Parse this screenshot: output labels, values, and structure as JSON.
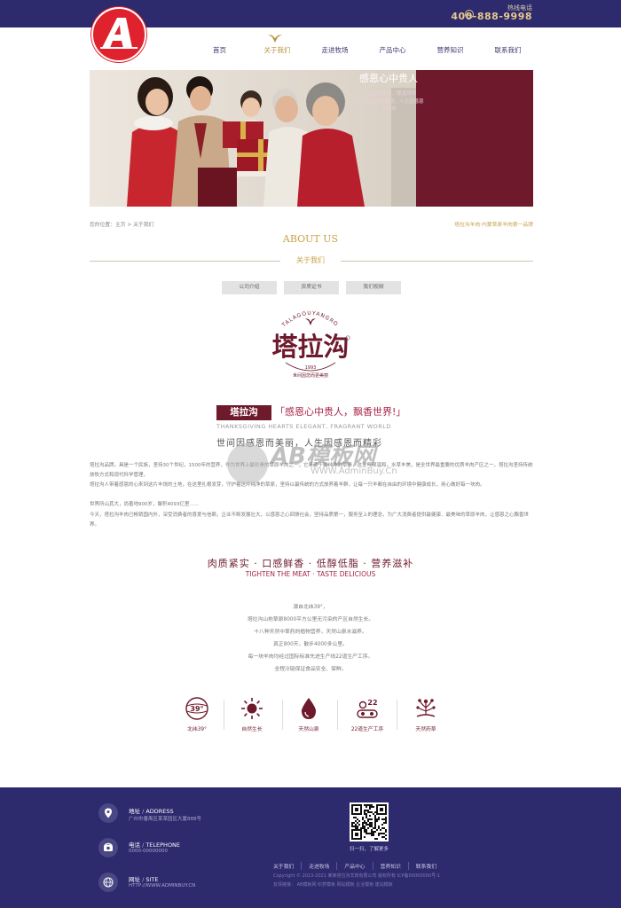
{
  "topbar": {
    "hotline_label": "热线电话",
    "hotline_number": "400-888-9998"
  },
  "nav": {
    "items": [
      "首页",
      "关于我们",
      "走进牧场",
      "产品中心",
      "营养知识",
      "联系我们"
    ],
    "active_index": 1
  },
  "banner": {
    "title": "感恩心中贵人",
    "lines": [
      "感恩心中贵人，飘香世界",
      "世间因感恩而美丽，人生因感恩而精彩"
    ]
  },
  "breadcrumb": "您的位置：主页 > 关于我们",
  "slogan_small": "塔拉沟羊肉·内蒙草原羊肉第一品牌",
  "about": {
    "title_en": "ABOUT US",
    "title_cn": "关于我们"
  },
  "tabs": [
    "公司介绍",
    "资质证书",
    "我们视频"
  ],
  "brand": {
    "name": "塔拉沟",
    "arc_text": "TALAGOUYANGROU",
    "year": "1993",
    "motto": "世间因您而更美丽"
  },
  "heading": {
    "tag": "塔拉沟",
    "quote": "「感恩心中贵人，飘香世界!」",
    "en": "THANKSGIVING HEARTS ELEGANT, FRAGRANT WORLD",
    "cn2": "世间因感恩而美丽，人生因感恩而精彩"
  },
  "paragraphs": [
    "塔拉沟品牌，具是一个民族，坚持30个世纪，1500年的营养，作为世界上最珍贵的草原羊肉之一，它来源于最纯净的草原，这里气候温和，水草丰美，是全世界最重要的优质羊肉产区之一，塔拉沟坚持传统放牧方式和现代科学管理，",
    "塔拉沟人带着感恩的心来到这片丰饶的土地，在这里扎根发芽，守护着这片纯净的草原，坚持以最传统的方式放养着羊群，让每一只羊都在自由的环境中健康成长，用心做好每一块肉。",
    "世界所山其大，尚善地900岁，聚积4093亿里……",
    "今天，塔拉沟羊肉已畅销国内外，深受消费者的喜爱与信赖，企业不断发展壮大，以感恩之心回馈社会，坚持品质第一，服务至上的理念，为广大消费者提供最健康、最美味的草原羊肉，让感恩之心飘香世界。"
  ],
  "watermark": {
    "main": "AB模板网",
    "url": "WWW.AdminBuy.Cn"
  },
  "features": {
    "title_cn": "肉质紧实 · 口感鲜香 · 低醇低脂 · 营养滋补",
    "title_en": "TIGHTEN THE MEAT · TASTE DELICIOUS",
    "poem": [
      "源自北纬39°，",
      "塔拉沟山地草原8000平方公里无污染的产区自然生长。",
      "十八种天然中草药的植物营养，天然山泉水滋养。",
      "真正800天，散步4000多公里。",
      "每一块羊肉均经过国际标准先进生产线22道生产工序。",
      "全程冷链保证食品安全、保鲜。"
    ],
    "icons": [
      {
        "icon": "latitude-39-icon",
        "label": "北纬39°"
      },
      {
        "icon": "sun-icon",
        "label": "自然生长"
      },
      {
        "icon": "water-drop-icon",
        "label": "天然山泉"
      },
      {
        "icon": "process-22-icon",
        "label": "22道生产工序"
      },
      {
        "icon": "herb-icon",
        "label": "天然药草"
      }
    ],
    "icon_color": "#6e1a2c"
  },
  "footer": {
    "address": {
      "label": "地址",
      "label_en": "ADDRESS",
      "value": "广州市番禺区某某园区大厦888号"
    },
    "phone": {
      "label": "电话",
      "label_en": "TELEPHONE",
      "value": "0000-00000000"
    },
    "web": {
      "label": "网址",
      "label_en": "SITE",
      "value": "HTTP://WWW.ADMINBUY.CN"
    },
    "qr_caption": "扫一扫，了解更多",
    "nav": [
      "关于我们",
      "走进牧场",
      "产品中心",
      "营养知识",
      "联系我们"
    ],
    "copyright": "Copyright © 2013-2021 某某塔拉沟羊肉有限公司 版权所有 ICP备00000000号-1",
    "links": "友情链接：  AB模板网   织梦模板   网站模板   企业模板   建站模板"
  },
  "colors": {
    "navy": "#2d2a6e",
    "maroon": "#6e1a2c",
    "gold": "#c9a24a"
  }
}
